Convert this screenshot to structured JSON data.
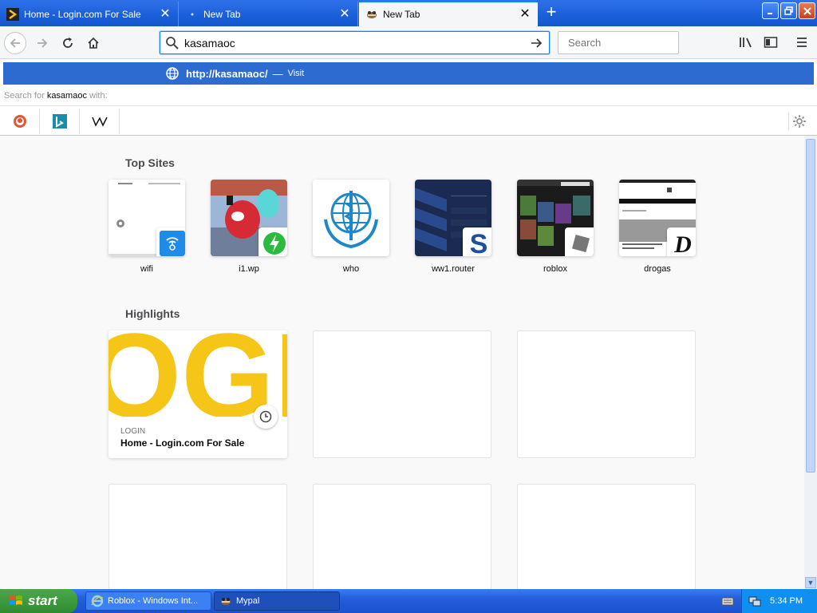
{
  "tabs": [
    {
      "label": "Home - Login.com For Sale",
      "close": "✕"
    },
    {
      "label": "New Tab",
      "close": "✕"
    },
    {
      "label": "New Tab",
      "close": "✕"
    }
  ],
  "new_tab_symbol": "+",
  "nav": {
    "url_value": "kasamaoc",
    "search_placeholder": "Search"
  },
  "popup": {
    "visit_url": "http://kasamaoc/",
    "visit_dash": "—",
    "visit_label": "Visit",
    "search_for_prefix": "Search for ",
    "search_term": "kasamaoc",
    "search_for_suffix": " with:"
  },
  "top_sites": {
    "title": "Top Sites",
    "items": [
      {
        "label": "wifi"
      },
      {
        "label": "i1.wp"
      },
      {
        "label": "who"
      },
      {
        "label": "ww1.router"
      },
      {
        "label": "roblox"
      },
      {
        "label": "drogas"
      }
    ]
  },
  "highlights": {
    "title": "Highlights",
    "card": {
      "source": "LOGIN",
      "title": "Home - Login.com For Sale",
      "image_text": "OGI"
    }
  },
  "taskbar": {
    "start_label": "start",
    "tasks": [
      {
        "label": "Roblox - Windows Int..."
      },
      {
        "label": "Mypal"
      }
    ],
    "clock": "5:34 PM"
  },
  "colors": {
    "accent": "#0a84ff",
    "popup_highlight": "#2e6bd0",
    "taskbar": "#245edb",
    "login_yellow": "#f5c518"
  }
}
